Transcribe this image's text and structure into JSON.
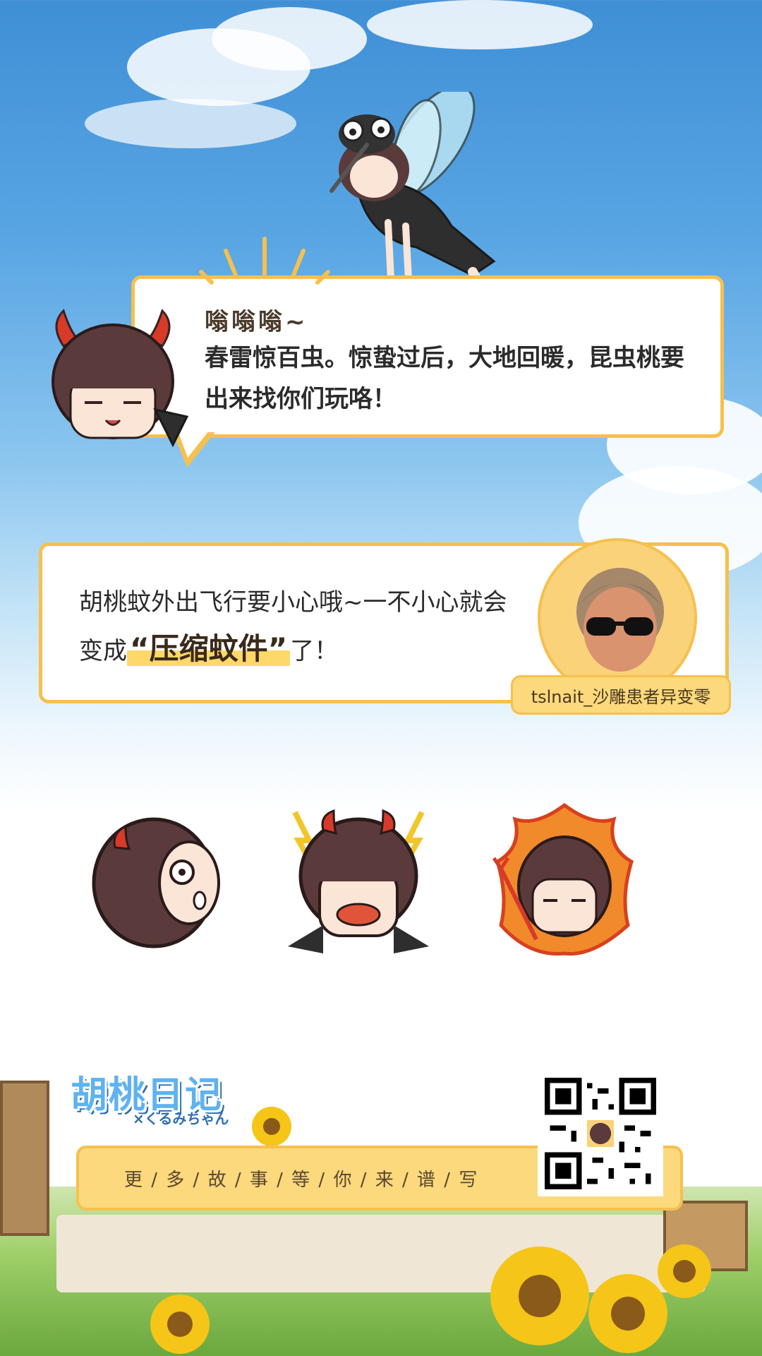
{
  "bubble1": {
    "heading": "嗡嗡嗡~",
    "text": "春雷惊百虫。惊蛰过后，大地回暖，昆虫桃要出来找你们玩咯！"
  },
  "bubble2": {
    "text_a": "胡桃蚊外出飞行要小心哦~一不小心就会变成",
    "highlight": "“压缩蚊件”",
    "text_b": "了！",
    "username": "tslnait_沙雕患者异变零"
  },
  "logo": {
    "title": "胡桃日记",
    "subtitle": "×くるみちゃん"
  },
  "more_bar": {
    "text": "更 / 多 / 故 / 事 / 等 / 你 / 来 / 谱 / 写"
  },
  "colors": {
    "accent": "#f6c04e",
    "accent_fill": "#fbd97c",
    "sky": "#4a96dc",
    "hair": "#5a3a3a",
    "horn": "#d83a2a"
  },
  "icons": {
    "qr": "qr-code-icon",
    "burst": "sound-burst-icon"
  }
}
